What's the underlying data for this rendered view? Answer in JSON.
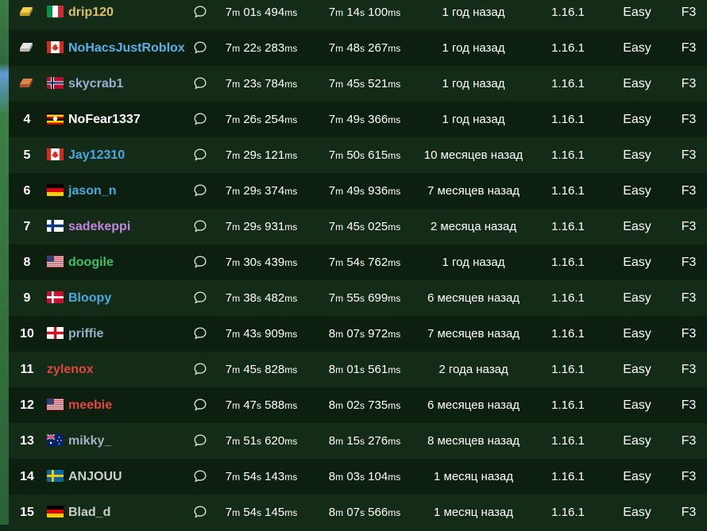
{
  "leaderboard": {
    "rows": [
      {
        "rank": "",
        "medal": "gold",
        "flag": "it",
        "name": "drip120",
        "name_color": "#d8c36a",
        "rta_m": "7",
        "rta_s": "01",
        "rta_ms": "494",
        "igt_m": "7",
        "igt_s": "14",
        "igt_ms": "100",
        "date": "1 год назад",
        "version": "1.16.1",
        "difficulty": "Easy",
        "category": "F3"
      },
      {
        "rank": "",
        "medal": "silver",
        "flag": "ca",
        "name": "NoHacsJustRoblox",
        "name_color": "#5ab0e8",
        "rta_m": "7",
        "rta_s": "22",
        "rta_ms": "283",
        "igt_m": "7",
        "igt_s": "48",
        "igt_ms": "267",
        "date": "1 год назад",
        "version": "1.16.1",
        "difficulty": "Easy",
        "category": "F3"
      },
      {
        "rank": "",
        "medal": "bronze",
        "flag": "no",
        "name": "skycrab1",
        "name_color": "#9ab0d0",
        "rta_m": "7",
        "rta_s": "23",
        "rta_ms": "784",
        "igt_m": "7",
        "igt_s": "45",
        "igt_ms": "521",
        "date": "1 год назад",
        "version": "1.16.1",
        "difficulty": "Easy",
        "category": "F3"
      },
      {
        "rank": "4",
        "medal": "",
        "flag": "ug",
        "name": "NoFear1337",
        "name_color": "#ffffff",
        "rta_m": "7",
        "rta_s": "26",
        "rta_ms": "254",
        "igt_m": "7",
        "igt_s": "49",
        "igt_ms": "366",
        "date": "1 год назад",
        "version": "1.16.1",
        "difficulty": "Easy",
        "category": "F3"
      },
      {
        "rank": "5",
        "medal": "",
        "flag": "ca",
        "name": "Jay12310",
        "name_color": "#4aa8e0",
        "rta_m": "7",
        "rta_s": "29",
        "rta_ms": "121",
        "igt_m": "7",
        "igt_s": "50",
        "igt_ms": "615",
        "date": "10 месяцев назад",
        "version": "1.16.1",
        "difficulty": "Easy",
        "category": "F3"
      },
      {
        "rank": "6",
        "medal": "",
        "flag": "de",
        "name": "jason_n",
        "name_color": "#4aa8e0",
        "rta_m": "7",
        "rta_s": "29",
        "rta_ms": "374",
        "igt_m": "7",
        "igt_s": "49",
        "igt_ms": "936",
        "date": "7 месяцев назад",
        "version": "1.16.1",
        "difficulty": "Easy",
        "category": "F3"
      },
      {
        "rank": "7",
        "medal": "",
        "flag": "fi",
        "name": "sadekeppi",
        "name_color": "#c086e0",
        "rta_m": "7",
        "rta_s": "29",
        "rta_ms": "931",
        "igt_m": "7",
        "igt_s": "45",
        "igt_ms": "025",
        "date": "2 месяца назад",
        "version": "1.16.1",
        "difficulty": "Easy",
        "category": "F3"
      },
      {
        "rank": "8",
        "medal": "",
        "flag": "us",
        "name": "doogile",
        "name_color": "#3fbf6a",
        "rta_m": "7",
        "rta_s": "30",
        "rta_ms": "439",
        "igt_m": "7",
        "igt_s": "54",
        "igt_ms": "762",
        "date": "1 год назад",
        "version": "1.16.1",
        "difficulty": "Easy",
        "category": "F3"
      },
      {
        "rank": "9",
        "medal": "",
        "flag": "dk",
        "name": "Bloopy",
        "name_color": "#4aa8e0",
        "rta_m": "7",
        "rta_s": "38",
        "rta_ms": "482",
        "igt_m": "7",
        "igt_s": "55",
        "igt_ms": "699",
        "date": "6 месяцев назад",
        "version": "1.16.1",
        "difficulty": "Easy",
        "category": "F3"
      },
      {
        "rank": "10",
        "medal": "",
        "flag": "gb-eng",
        "name": "priffie",
        "name_color": "#8fb0c8",
        "rta_m": "7",
        "rta_s": "43",
        "rta_ms": "909",
        "igt_m": "8",
        "igt_s": "07",
        "igt_ms": "972",
        "date": "7 месяцев назад",
        "version": "1.16.1",
        "difficulty": "Easy",
        "category": "F3"
      },
      {
        "rank": "11",
        "medal": "",
        "flag": "",
        "name": "zylenox",
        "name_color": "#e0463f",
        "rta_m": "7",
        "rta_s": "45",
        "rta_ms": "828",
        "igt_m": "8",
        "igt_s": "01",
        "igt_ms": "561",
        "date": "2 года назад",
        "version": "1.16.1",
        "difficulty": "Easy",
        "category": "F3"
      },
      {
        "rank": "12",
        "medal": "",
        "flag": "us",
        "name": "meebie",
        "name_color": "#e0463f",
        "rta_m": "7",
        "rta_s": "47",
        "rta_ms": "588",
        "igt_m": "8",
        "igt_s": "02",
        "igt_ms": "735",
        "date": "6 месяцев назад",
        "version": "1.16.1",
        "difficulty": "Easy",
        "category": "F3"
      },
      {
        "rank": "13",
        "medal": "",
        "flag": "au",
        "name": "mikky_",
        "name_color": "#a8b0c8",
        "rta_m": "7",
        "rta_s": "51",
        "rta_ms": "620",
        "igt_m": "8",
        "igt_s": "15",
        "igt_ms": "276",
        "date": "8 месяцев назад",
        "version": "1.16.1",
        "difficulty": "Easy",
        "category": "F3"
      },
      {
        "rank": "14",
        "medal": "",
        "flag": "se",
        "name": "ANJOUU",
        "name_color": "#c8d0c8",
        "rta_m": "7",
        "rta_s": "54",
        "rta_ms": "143",
        "igt_m": "8",
        "igt_s": "03",
        "igt_ms": "104",
        "date": "1 месяц назад",
        "version": "1.16.1",
        "difficulty": "Easy",
        "category": "F3"
      },
      {
        "rank": "15",
        "medal": "",
        "flag": "de",
        "name": "Blad_d",
        "name_color": "#c8d0c8",
        "rta_m": "7",
        "rta_s": "54",
        "rta_ms": "145",
        "igt_m": "8",
        "igt_s": "07",
        "igt_ms": "566",
        "date": "1 месяц назад",
        "version": "1.16.1",
        "difficulty": "Easy",
        "category": "F3"
      }
    ]
  },
  "units": {
    "minute": "m",
    "second": "s",
    "millisecond": "ms"
  },
  "icons": {
    "comment": "chat-bubble-icon"
  }
}
